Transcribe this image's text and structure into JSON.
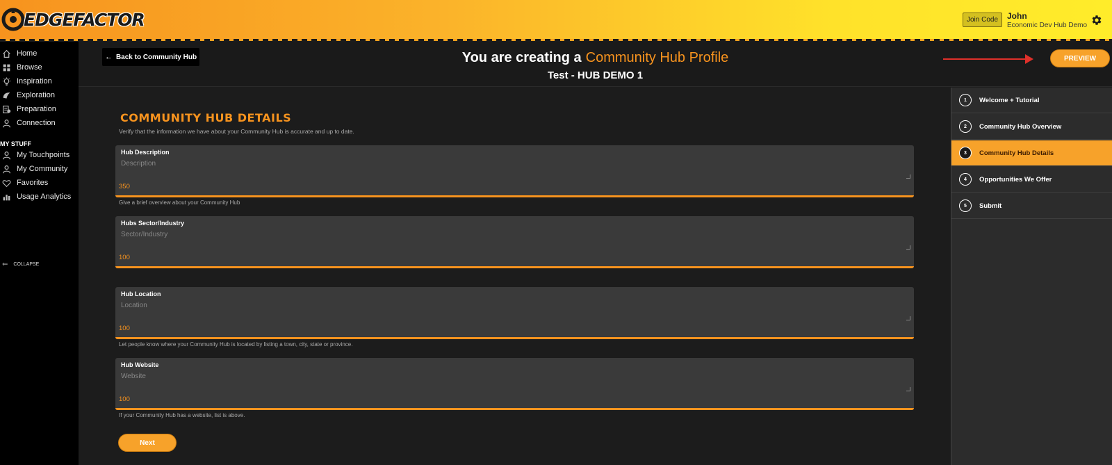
{
  "topbar": {
    "logo_text": "EDGEFACTOR",
    "join_code_label": "Join Code",
    "user_name": "John",
    "user_org": "Economic Dev Hub Demo",
    "icons": [
      "logo-icon",
      "gear-icon"
    ]
  },
  "sidebar": {
    "items": [
      {
        "label": "Home",
        "icon": "home-icon"
      },
      {
        "label": "Browse",
        "icon": "grid-icon"
      },
      {
        "label": "Inspiration",
        "icon": "lightbulb-icon"
      },
      {
        "label": "Exploration",
        "icon": "compass-icon"
      },
      {
        "label": "Preparation",
        "icon": "clipboard-icon"
      },
      {
        "label": "Connection",
        "icon": "people-icon"
      }
    ],
    "section_label": "MY STUFF",
    "my_items": [
      {
        "label": "My Touchpoints",
        "icon": "user-icon"
      },
      {
        "label": "My Community",
        "icon": "user-icon"
      },
      {
        "label": "Favorites",
        "icon": "heart-icon"
      },
      {
        "label": "Usage Analytics",
        "icon": "chart-icon"
      }
    ],
    "collapse_label": "COLLAPSE"
  },
  "header": {
    "back_label": "Back to Community Hub",
    "title_prefix": "You are creating a",
    "title_highlight": "Community Hub Profile",
    "subtitle": "Test - HUB DEMO 1",
    "preview_label": "PREVIEW"
  },
  "form": {
    "section_title": "COMMUNITY HUB DETAILS",
    "section_desc": "Verify that the information we have about your Community Hub is accurate and up to date.",
    "fields": [
      {
        "label": "Hub Description",
        "placeholder": "Description",
        "count": "350",
        "hint": "Give a brief overview about your Community Hub"
      },
      {
        "label": "Hubs Sector/Industry",
        "placeholder": "Sector/Industry",
        "count": "100",
        "hint": ""
      },
      {
        "label": "Hub Location",
        "placeholder": "Location",
        "count": "100",
        "hint": "Let people know where your Community Hub is located by listing a town, city, state or province."
      },
      {
        "label": "Hub Website",
        "placeholder": "Website",
        "count": "100",
        "hint": "If your Community Hub has a website, list is above."
      }
    ],
    "next_label": "Next"
  },
  "steps": [
    {
      "num": "1",
      "label": "Welcome + Tutorial",
      "active": false
    },
    {
      "num": "2",
      "label": "Community Hub Overview",
      "active": false
    },
    {
      "num": "3",
      "label": "Community Hub Details",
      "active": true
    },
    {
      "num": "4",
      "label": "Opportunities We Offer",
      "active": false
    },
    {
      "num": "5",
      "label": "Submit",
      "active": false
    }
  ],
  "colors": {
    "accent": "#f7931e",
    "annotation_arrow": "#e0302a"
  }
}
